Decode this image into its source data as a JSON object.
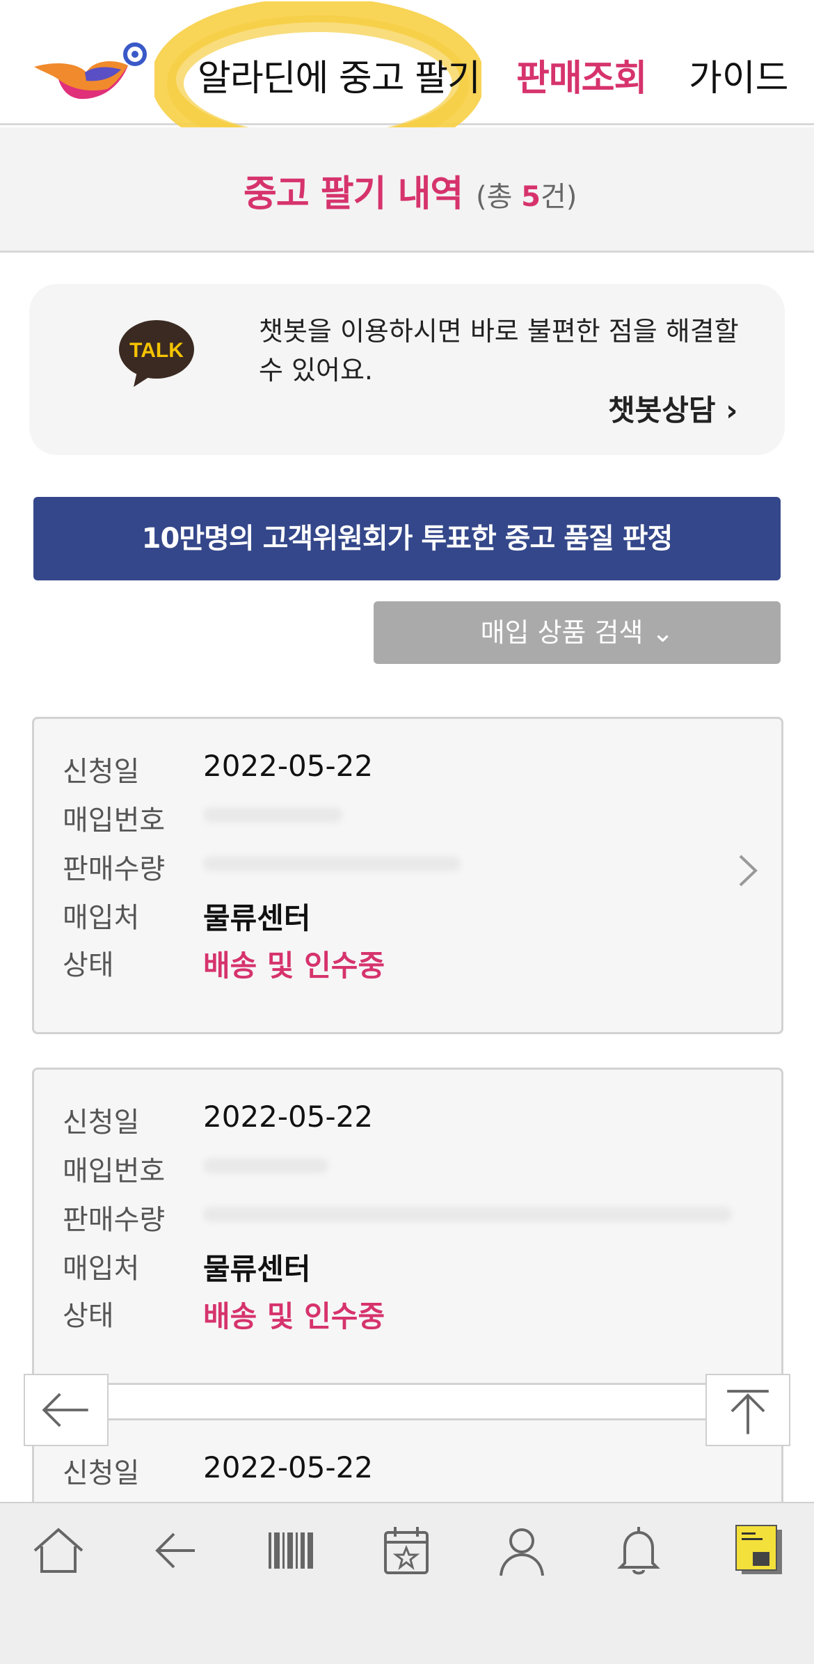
{
  "header": {
    "nav_sell": "알라딘에 중고 팔기",
    "nav_lookup": "판매조회",
    "nav_guide": "가이드"
  },
  "title": {
    "main": "중고 팔기 내역",
    "count_prefix": "(총 ",
    "count_number": "5",
    "count_suffix": "건)"
  },
  "chatbot": {
    "icon_text": "TALK",
    "message": "챗봇을 이용하시면 바로 불편한 점을 해결할 수 있어요.",
    "link_label": "챗봇상담 ›"
  },
  "banner": {
    "label": "10만명의 고객위원회가 투표한 중고 품질 판정"
  },
  "search": {
    "label": "매입 상품 검색 ⌄"
  },
  "orders": [
    {
      "labels": [
        "신청일",
        "매입번호",
        "판매수량",
        "매입처",
        "상태"
      ],
      "date": "2022-05-22",
      "place": "물류센터",
      "status": "배송 및 인수중"
    },
    {
      "labels": [
        "신청일",
        "매입번호",
        "판매수량",
        "매입처",
        "상태"
      ],
      "date": "2022-05-22",
      "place": "물류센터",
      "status": "배송 및 인수중"
    },
    {
      "labels": [
        "신청일"
      ],
      "date": "2022-05-22"
    }
  ],
  "colors": {
    "accent": "#d6336c",
    "banner": "#34478a",
    "highlight": "#f7cf45"
  },
  "bottom_nav": [
    "home-icon",
    "back-arrow-icon",
    "barcode-icon",
    "calendar-star-icon",
    "person-icon",
    "bell-icon",
    "book-thumbnail-icon"
  ]
}
